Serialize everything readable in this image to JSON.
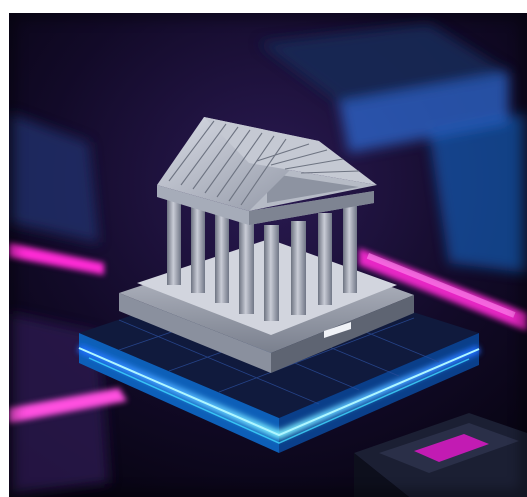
{
  "scene": {
    "subject": "classical-bank-building-icon",
    "palette": {
      "background_dark": "#0b0618",
      "deep_navy": "#141a3a",
      "neon_blue": "#3fd8ff",
      "neon_cyan": "#7ef2ff",
      "neon_magenta": "#ff2bd6",
      "violet": "#7b2bff",
      "stone_light": "#c9ccd6",
      "stone_mid": "#9aa0ae",
      "stone_dark": "#5e6472"
    }
  }
}
